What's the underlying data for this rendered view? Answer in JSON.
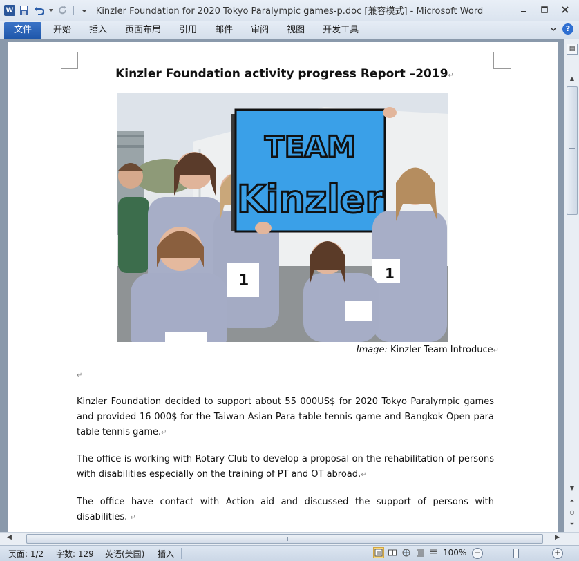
{
  "window": {
    "title": "Kinzler Foundation for 2020 Tokyo Paralympic games-p.doc [兼容模式]  -  Microsoft Word",
    "app_logo": "W",
    "controls": [
      "minimize-icon",
      "maximize-icon",
      "close-icon"
    ]
  },
  "quick_access": {
    "icons": [
      "word-logo-icon",
      "save-icon",
      "undo-icon",
      "redo-icon",
      "customize-dropdown-icon"
    ]
  },
  "ribbon": {
    "file_tab": "文件",
    "tabs": [
      "开始",
      "插入",
      "页面布局",
      "引用",
      "邮件",
      "审阅",
      "视图",
      "开发工具"
    ]
  },
  "document": {
    "title": "Kinzler Foundation  activity progress Report –2019",
    "paragraph_mark": "↵",
    "image_sign": "TEAM Kinzler",
    "caption_label": "Image:",
    "caption_text": " Kinzler Team Introduce",
    "paragraphs": [
      "Kinzler Foundation decided to support about 55 000US$ for 2020 Tokyo Paralympic games and provided 16 000$ for the Taiwan Asian Para table tennis game and Bangkok Open para table tennis game.",
      "The office is working with Rotary Club to develop a proposal on the rehabilitation of persons with disabilities especially on the training of PT and OT abroad.",
      "The office have contact with Action aid and discussed the support of persons with disabilities. "
    ]
  },
  "status_bar": {
    "page": "页面: 1/2",
    "words": "字数: 129",
    "language": "英语(美国)",
    "mode": "插入",
    "zoom": "100%",
    "zoom_minus": "−",
    "zoom_plus": "+"
  },
  "colors": {
    "file_tab": "#2b5fb3",
    "page_background": "#8a99ab",
    "sign_blue": "#3aa0e8"
  }
}
